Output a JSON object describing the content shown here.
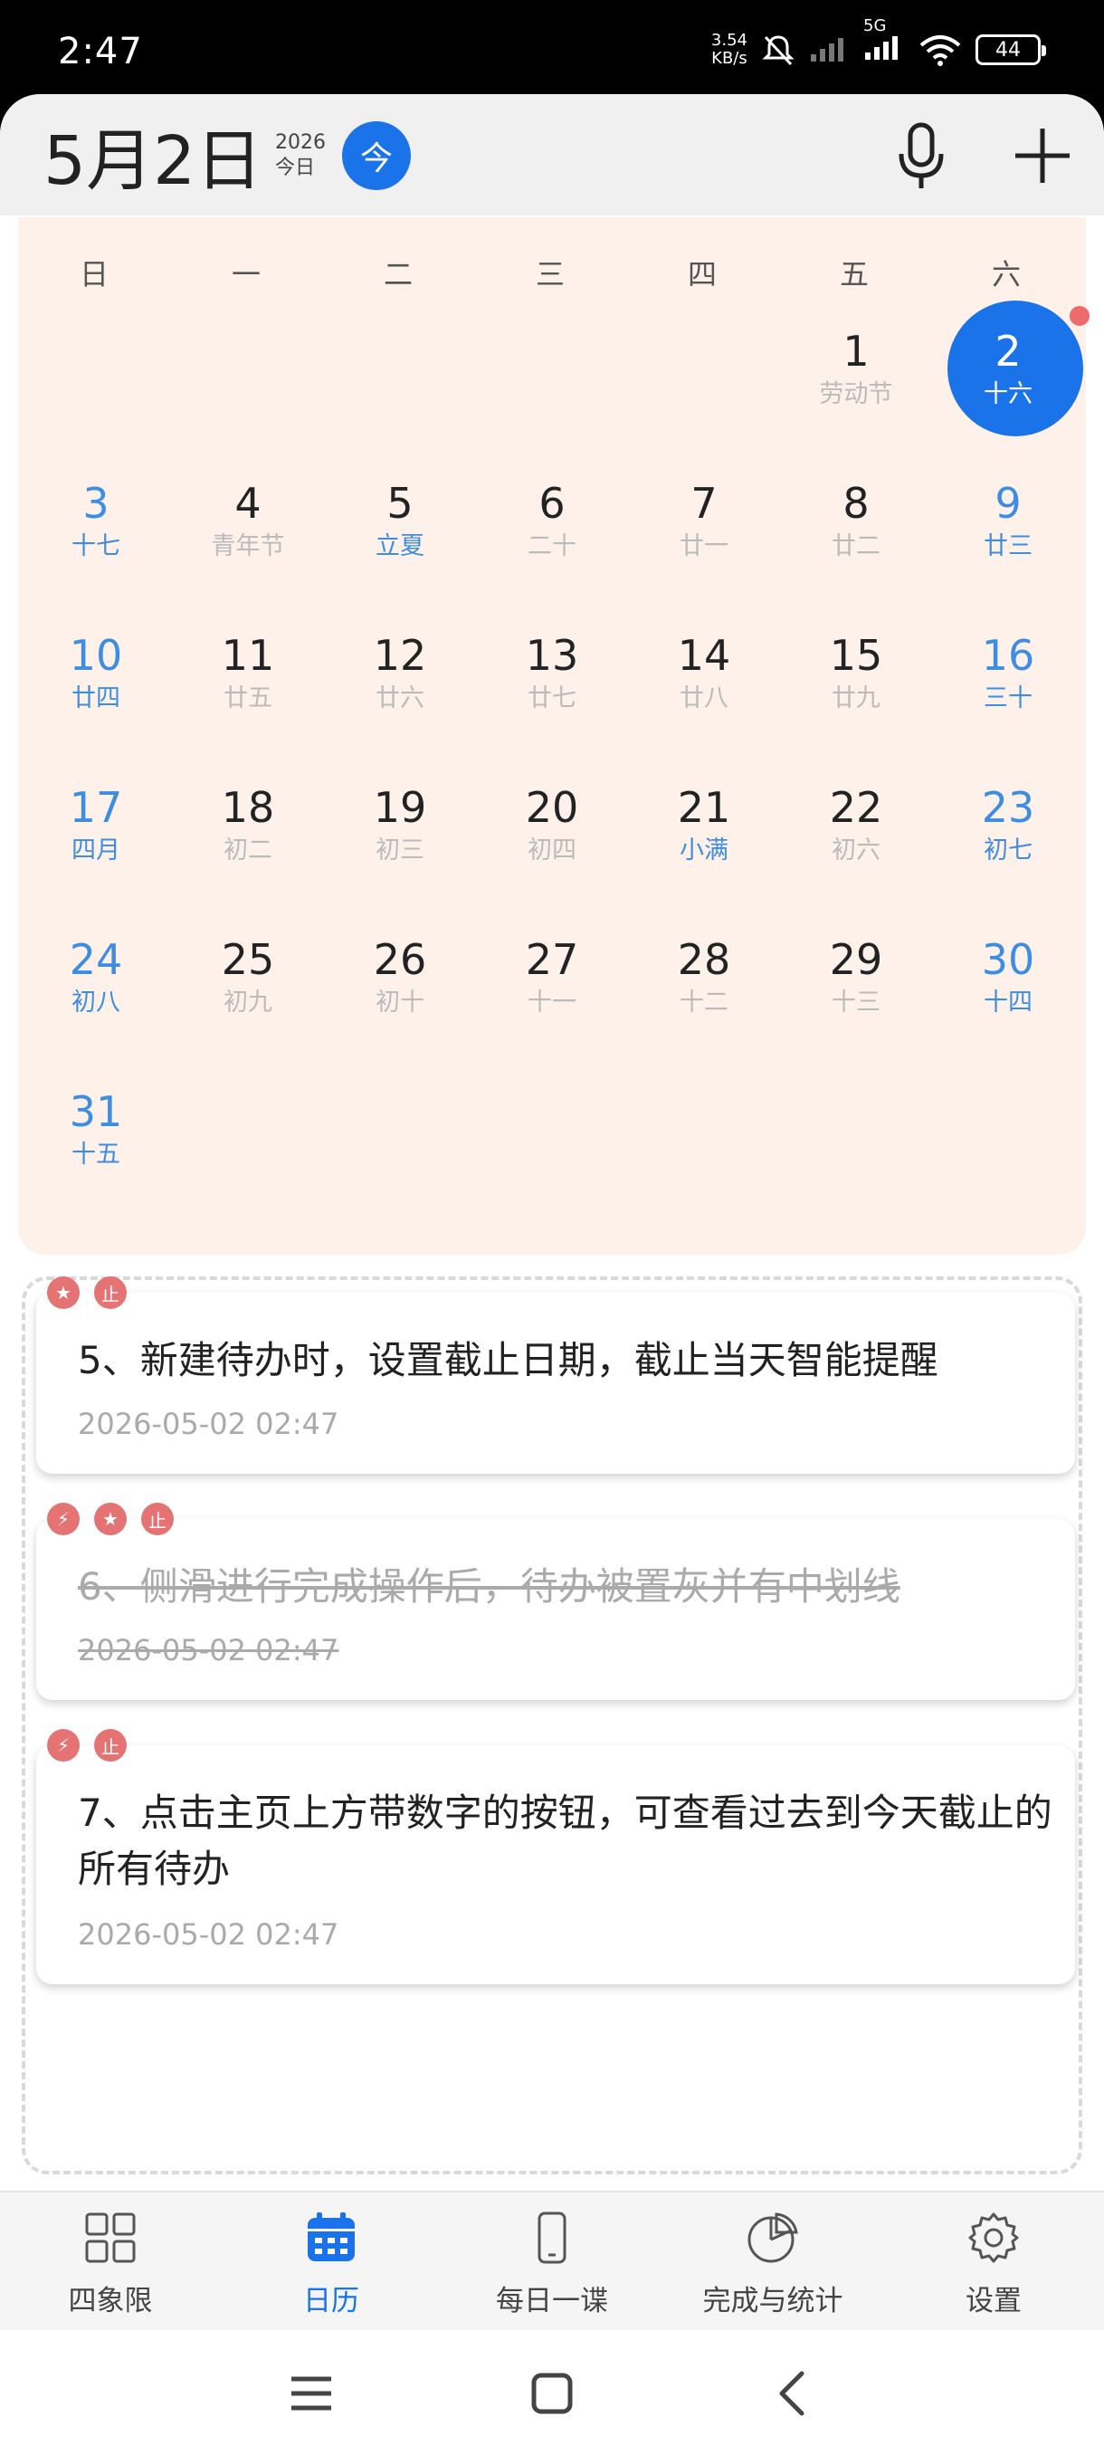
{
  "status_bar": {
    "time": "2:47",
    "net_speed_value": "3.54",
    "net_speed_unit": "KB/s",
    "network": "5G",
    "battery": "44"
  },
  "header": {
    "date": "5月2日",
    "year": "2026",
    "today_label": "今日",
    "today_button": "今",
    "icons": [
      "mic-icon",
      "plus-icon"
    ]
  },
  "calendar": {
    "weekdays": [
      "日",
      "一",
      "二",
      "三",
      "四",
      "五",
      "六"
    ],
    "selected_day": "2",
    "days": [
      {
        "d": "1",
        "sub": "劳动节"
      },
      {
        "d": "2",
        "sub": "十六"
      },
      {
        "d": "3",
        "sub": "十七"
      },
      {
        "d": "4",
        "sub": "青年节"
      },
      {
        "d": "5",
        "sub": "立夏"
      },
      {
        "d": "6",
        "sub": "二十"
      },
      {
        "d": "7",
        "sub": "廿一"
      },
      {
        "d": "8",
        "sub": "廿二"
      },
      {
        "d": "9",
        "sub": "廿三"
      },
      {
        "d": "10",
        "sub": "廿四"
      },
      {
        "d": "11",
        "sub": "廿五"
      },
      {
        "d": "12",
        "sub": "廿六"
      },
      {
        "d": "13",
        "sub": "廿七"
      },
      {
        "d": "14",
        "sub": "廿八"
      },
      {
        "d": "15",
        "sub": "廿九"
      },
      {
        "d": "16",
        "sub": "三十"
      },
      {
        "d": "17",
        "sub": "四月"
      },
      {
        "d": "18",
        "sub": "初二"
      },
      {
        "d": "19",
        "sub": "初三"
      },
      {
        "d": "20",
        "sub": "初四"
      },
      {
        "d": "21",
        "sub": "小满"
      },
      {
        "d": "22",
        "sub": "初六"
      },
      {
        "d": "23",
        "sub": "初七"
      },
      {
        "d": "24",
        "sub": "初八"
      },
      {
        "d": "25",
        "sub": "初九"
      },
      {
        "d": "26",
        "sub": "初十"
      },
      {
        "d": "27",
        "sub": "十一"
      },
      {
        "d": "28",
        "sub": "十二"
      },
      {
        "d": "29",
        "sub": "十三"
      },
      {
        "d": "30",
        "sub": "十四"
      },
      {
        "d": "31",
        "sub": "十五"
      }
    ]
  },
  "todos": [
    {
      "title": "5、新建待办时，设置截止日期，截止当天智能提醒",
      "time": "2026-05-02 02:47",
      "done": false,
      "badges": [
        "star-icon",
        "deadline-icon"
      ],
      "badge_text": [
        "★",
        "止"
      ]
    },
    {
      "title": "6、侧滑进行完成操作后，待办被置灰并有中划线",
      "time": "2026-05-02 02:47",
      "done": true,
      "badges": [
        "lightning-icon",
        "star-icon",
        "deadline-icon"
      ],
      "badge_text": [
        "⚡",
        "★",
        "止"
      ]
    },
    {
      "title": "7、点击主页上方带数字的按钮，可查看过去到今天截止的所有待办",
      "time": "2026-05-02 02:47",
      "done": false,
      "badges": [
        "lightning-icon",
        "deadline-icon"
      ],
      "badge_text": [
        "⚡",
        "止"
      ]
    }
  ],
  "bottom_nav": [
    {
      "label": "四象限",
      "icon": "grid-icon",
      "active": false
    },
    {
      "label": "日历",
      "icon": "calendar-icon",
      "active": true
    },
    {
      "label": "每日一谍",
      "icon": "phone-icon",
      "active": false
    },
    {
      "label": "完成与统计",
      "icon": "pie-chart-icon",
      "active": false
    },
    {
      "label": "设置",
      "icon": "gear-icon",
      "active": false
    }
  ],
  "colors": {
    "accent": "#1a73e8",
    "calendar_bg": "#fdf1ea",
    "weekend": "#3f8de0",
    "badge": "#e57373",
    "dot": "#ef6b6b"
  }
}
